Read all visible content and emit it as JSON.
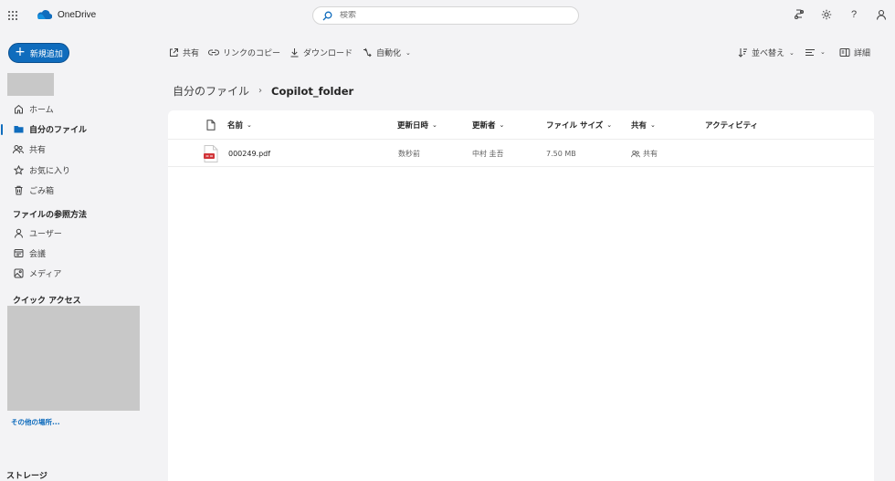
{
  "app": {
    "name": "OneDrive"
  },
  "search": {
    "placeholder": "検索"
  },
  "sidebar": {
    "new_label": "新規追加",
    "items": [
      {
        "label": "ホーム",
        "icon": "home-icon"
      },
      {
        "label": "自分のファイル",
        "icon": "folder-icon",
        "active": true
      },
      {
        "label": "共有",
        "icon": "people-icon"
      },
      {
        "label": "お気に入り",
        "icon": "star-icon"
      },
      {
        "label": "ごみ箱",
        "icon": "trash-icon"
      }
    ],
    "browse_title": "ファイルの参照方法",
    "browse_items": [
      {
        "label": "ユーザー",
        "icon": "person-icon"
      },
      {
        "label": "会議",
        "icon": "meeting-icon"
      },
      {
        "label": "メディア",
        "icon": "image-icon"
      }
    ],
    "quick_access_title": "クイック アクセス",
    "more_places": "その他の場所...",
    "storage": "ストレージ"
  },
  "commands": {
    "share": "共有",
    "copy_link": "リンクのコピー",
    "download": "ダウンロード",
    "automate": "自動化",
    "sort": "並べ替え",
    "details": "詳細"
  },
  "breadcrumb": {
    "parent": "自分のファイル",
    "current": "Copilot_folder"
  },
  "table": {
    "columns": {
      "name": "名前",
      "modified": "更新日時",
      "modified_by": "更新者",
      "size": "ファイル サイズ",
      "sharing": "共有",
      "activity": "アクティビティ"
    },
    "rows": [
      {
        "name": "000249.pdf",
        "modified": "数秒前",
        "modified_by": "中村 圭吾",
        "size": "7.50 MB",
        "sharing": "共有"
      }
    ]
  },
  "colors": {
    "accent": "#0f6cbd",
    "pdf": "#d13438"
  }
}
